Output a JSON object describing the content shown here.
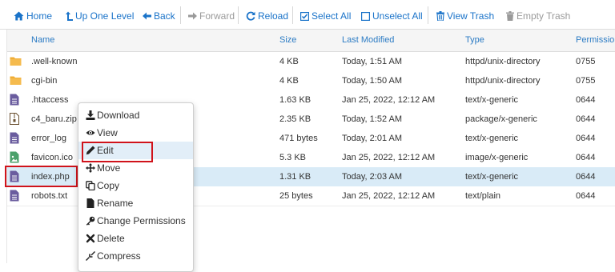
{
  "toolbar": {
    "home": "Home",
    "up": "Up One Level",
    "back": "Back",
    "forward": "Forward",
    "reload": "Reload",
    "select_all": "Select All",
    "unselect_all": "Unselect All",
    "view_trash": "View Trash",
    "empty_trash": "Empty Trash"
  },
  "columns": {
    "name": "Name",
    "size": "Size",
    "modified": "Last Modified",
    "type": "Type",
    "perms": "Permission"
  },
  "files": [
    {
      "name": ".well-known",
      "size": "4 KB",
      "modified": "Today, 1:51 AM",
      "type": "httpd/unix-directory",
      "perms": "0755",
      "icon": "folder-icon"
    },
    {
      "name": "cgi-bin",
      "size": "4 KB",
      "modified": "Today, 1:50 AM",
      "type": "httpd/unix-directory",
      "perms": "0755",
      "icon": "folder-icon"
    },
    {
      "name": ".htaccess",
      "size": "1.63 KB",
      "modified": "Jan 25, 2022, 12:12 AM",
      "type": "text/x-generic",
      "perms": "0644",
      "icon": "text-file-icon"
    },
    {
      "name": "c4_baru.zip",
      "size": "2.35 KB",
      "modified": "Today, 1:52 AM",
      "type": "package/x-generic",
      "perms": "0644",
      "icon": "zip-file-icon"
    },
    {
      "name": "error_log",
      "size": "471 bytes",
      "modified": "Today, 2:01 AM",
      "type": "text/x-generic",
      "perms": "0644",
      "icon": "text-file-icon"
    },
    {
      "name": "favicon.ico",
      "size": "5.3 KB",
      "modified": "Jan 25, 2022, 12:12 AM",
      "type": "image/x-generic",
      "perms": "0644",
      "icon": "image-file-icon"
    },
    {
      "name": "index.php",
      "size": "1.31 KB",
      "modified": "Today, 2:03 AM",
      "type": "text/x-generic",
      "perms": "0644",
      "icon": "text-file-icon",
      "selected": true
    },
    {
      "name": "robots.txt",
      "size": "25 bytes",
      "modified": "Jan 25, 2022, 12:12 AM",
      "type": "text/plain",
      "perms": "0644",
      "icon": "text-file-icon"
    }
  ],
  "context_menu": {
    "items": [
      {
        "label": "Download",
        "icon": "download-icon"
      },
      {
        "label": "View",
        "icon": "eye-icon"
      },
      {
        "label": "Edit",
        "icon": "pencil-icon",
        "highlighted": true
      },
      {
        "label": "Move",
        "icon": "move-arrows-icon"
      },
      {
        "label": "Copy",
        "icon": "copy-icon"
      },
      {
        "label": "Rename",
        "icon": "rename-file-icon"
      },
      {
        "label": "Change Permissions",
        "icon": "key-icon"
      },
      {
        "label": "Delete",
        "icon": "x-delete-icon"
      },
      {
        "label": "Compress",
        "icon": "compress-icon"
      }
    ]
  },
  "colors": {
    "link": "#1a73c9",
    "disabled": "#9a9a9a",
    "folder": "#f0ad35",
    "text_file": "#6a5c9e",
    "image_file": "#4aa06a",
    "selected_row": "#d9ebf7",
    "highlight_box": "#d0131b"
  }
}
